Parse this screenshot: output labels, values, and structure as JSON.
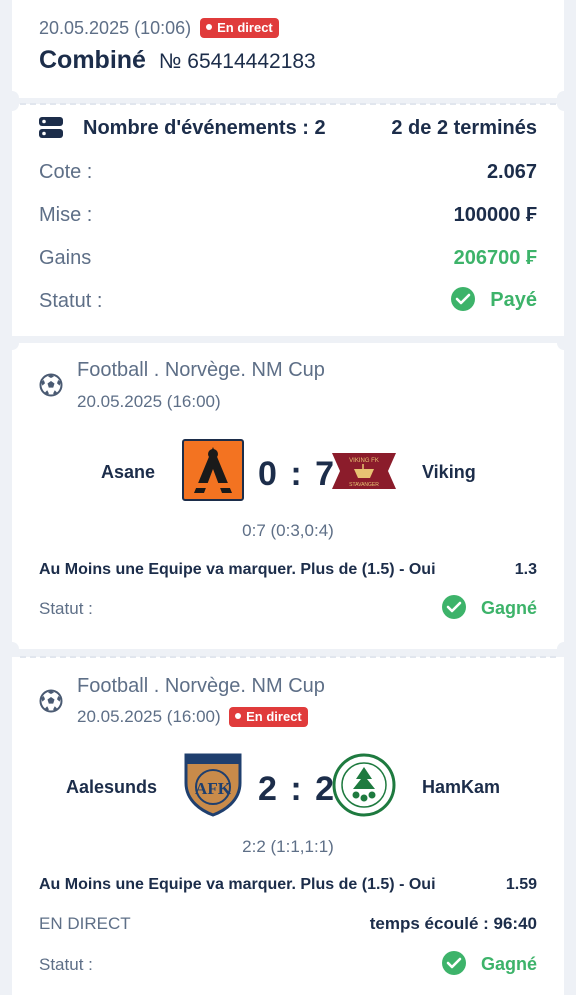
{
  "header": {
    "datetime": "20.05.2025 (10:06)",
    "live_badge": "En direct",
    "bet_type": "Combiné",
    "bet_number": "№ 65414442183"
  },
  "summary": {
    "events_label": "Nombre d'événements : 2",
    "finished_label": "2 de 2 terminés",
    "cote_label": "Cote :",
    "cote_value": "2.067",
    "mise_label": "Mise :",
    "mise_value": "100000 ₣",
    "gains_label": "Gains",
    "gains_value": "206700 ₣",
    "statut_label": "Statut :",
    "statut_value": "Payé"
  },
  "events": [
    {
      "title": "Football . Norvège. NM Cup",
      "date": "20.05.2025 (16:00)",
      "home": "Asane",
      "away": "Viking",
      "score": "0 : 7",
      "subscore": "0:7 (0:3,0:4)",
      "bet": "Au Moins une Equipe va marquer. Plus de (1.5) - Oui",
      "odd": "1.3",
      "statut_label": "Statut :",
      "statut_value": "Gagné",
      "away_logo_text_top": "VIKING FK",
      "away_logo_text_bottom": "STAVANGER"
    },
    {
      "title": "Football . Norvège. NM Cup",
      "date": "20.05.2025 (16:00)",
      "live_badge": "En direct",
      "home": "Aalesunds",
      "away": "HamKam",
      "score": "2 : 2",
      "subscore": "2:2 (1:1,1:1)",
      "bet": "Au Moins une Equipe va marquer. Plus de (1.5) - Oui",
      "odd": "1.59",
      "live_label": "EN DIRECT",
      "elapsed": "temps écoulé : 96:40",
      "statut_label": "Statut :",
      "statut_value": "Gagné",
      "home_logo_text": "AFK"
    }
  ],
  "colors": {
    "accent_green": "#3db36a",
    "live_red": "#e03b3b",
    "text_dark": "#1c2d4a",
    "text_muted": "#5e6f87"
  }
}
